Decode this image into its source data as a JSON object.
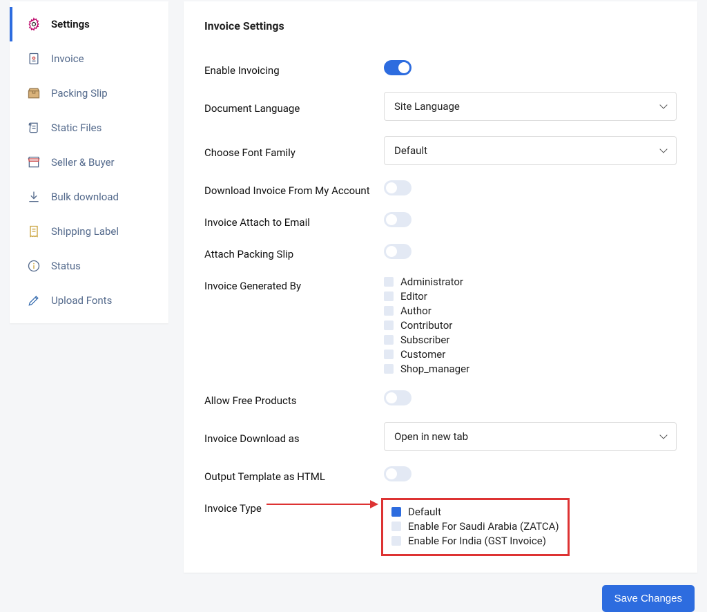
{
  "sidebar": {
    "items": [
      {
        "label": "Settings",
        "active": true
      },
      {
        "label": "Invoice"
      },
      {
        "label": "Packing Slip"
      },
      {
        "label": "Static Files"
      },
      {
        "label": "Seller & Buyer"
      },
      {
        "label": "Bulk download"
      },
      {
        "label": "Shipping Label"
      },
      {
        "label": "Status"
      },
      {
        "label": "Upload Fonts"
      }
    ]
  },
  "panel": {
    "title": "Invoice Settings",
    "rows": {
      "enable_invoicing": {
        "label": "Enable Invoicing",
        "on": true
      },
      "doc_language": {
        "label": "Document Language",
        "value": "Site Language"
      },
      "font_family": {
        "label": "Choose Font Family",
        "value": "Default"
      },
      "download_my_account": {
        "label": "Download Invoice From My Account",
        "on": false
      },
      "attach_email": {
        "label": "Invoice Attach to Email",
        "on": false
      },
      "attach_packing": {
        "label": "Attach Packing Slip",
        "on": false
      },
      "generated_by": {
        "label": "Invoice Generated By",
        "options": [
          {
            "label": "Administrator",
            "checked": false
          },
          {
            "label": "Editor",
            "checked": false
          },
          {
            "label": "Author",
            "checked": false
          },
          {
            "label": "Contributor",
            "checked": false
          },
          {
            "label": "Subscriber",
            "checked": false
          },
          {
            "label": "Customer",
            "checked": false
          },
          {
            "label": "Shop_manager",
            "checked": false
          }
        ]
      },
      "allow_free": {
        "label": "Allow Free Products",
        "on": false
      },
      "download_as": {
        "label": "Invoice Download as",
        "value": "Open in new tab"
      },
      "output_html": {
        "label": "Output Template as HTML",
        "on": false
      },
      "invoice_type": {
        "label": "Invoice Type",
        "options": [
          {
            "label": "Default",
            "checked": true
          },
          {
            "label": "Enable For Saudi Arabia (ZATCA)",
            "checked": false
          },
          {
            "label": "Enable For India (GST Invoice)",
            "checked": false
          }
        ]
      }
    }
  },
  "footer": {
    "save_label": "Save Changes"
  }
}
